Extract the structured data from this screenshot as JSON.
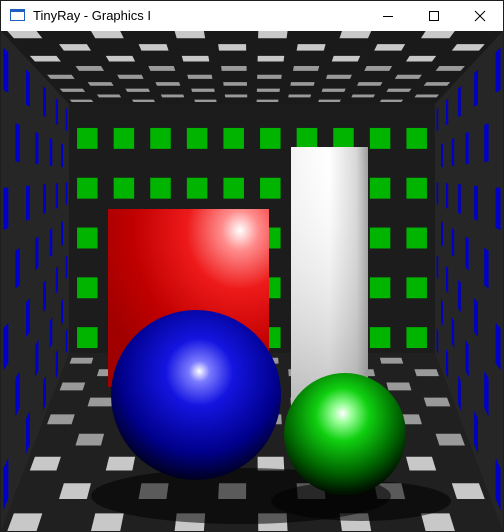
{
  "window": {
    "title": "TinyRay - Graphics I",
    "icon": "window-app-icon",
    "controls": {
      "minimize": "minimize-icon",
      "maximize": "maximize-icon",
      "close": "close-icon"
    }
  },
  "scene": {
    "walls_color": "#1e1e1e",
    "tile_light": "#c8c8c8",
    "tile_dark": "#9a9a9a",
    "back_wall_tile": "#00b400",
    "side_wall_tile": "#0000c8",
    "objects": [
      {
        "name": "red-box",
        "color": "#e00000"
      },
      {
        "name": "white-pillar",
        "color": "#e8e8e8"
      },
      {
        "name": "blue-sphere",
        "color": "#0000c0"
      },
      {
        "name": "green-sphere",
        "color": "#00c000"
      }
    ]
  }
}
